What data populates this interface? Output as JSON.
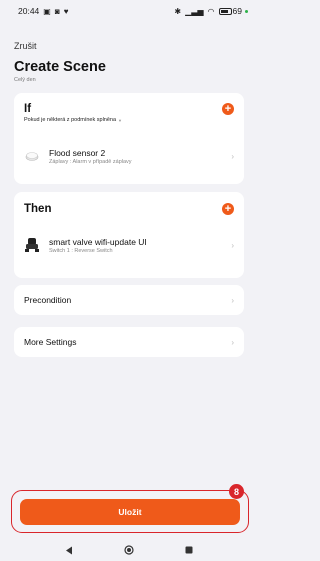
{
  "status_bar": {
    "time": "20:44",
    "battery": "69"
  },
  "header": {
    "cancel_label": "Zrušit",
    "title": "Create Scene",
    "subtitle": "Celý den"
  },
  "if_section": {
    "title": "If",
    "condition_text": "Pokud je některá z podmínek splněna",
    "items": [
      {
        "name": "Flood sensor 2",
        "detail": "Záplavy : Alarm v případě záplavy"
      }
    ]
  },
  "then_section": {
    "title": "Then",
    "items": [
      {
        "name": "smart valve wifi-update UI",
        "detail": "Switch 1 : Reverse Switch"
      }
    ]
  },
  "precondition": {
    "label": "Precondition"
  },
  "more_settings": {
    "label": "More Settings"
  },
  "save": {
    "label": "Uložit",
    "badge": "8"
  },
  "colors": {
    "accent": "#ef5a1a",
    "highlight": "#d9262b",
    "background": "#f2f2f6"
  },
  "icons": [
    "gallery-icon",
    "camera-icon",
    "notification-icon",
    "bluetooth-icon",
    "wifi-icon",
    "battery-icon",
    "flood-sensor-icon",
    "valve-icon",
    "chevron-right-icon",
    "add-icon",
    "back-icon",
    "home-icon",
    "recents-icon"
  ]
}
